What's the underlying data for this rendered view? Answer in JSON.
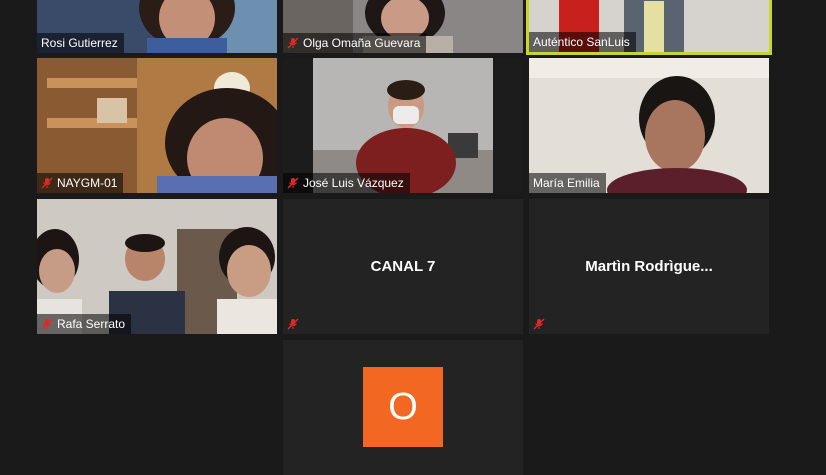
{
  "participants": [
    {
      "name": "Rosi Gutierrez",
      "muted": false
    },
    {
      "name": "Olga Omaña Guevara",
      "muted": true
    },
    {
      "name": "Auténtico SanLuis",
      "muted": false,
      "active_speaker": true
    },
    {
      "name": "NAYGM-01",
      "muted": true
    },
    {
      "name": "José Luis Vázquez",
      "muted": true
    },
    {
      "name": "María Emilia",
      "muted": false
    },
    {
      "name": "Rafa Serrato",
      "muted": true
    },
    {
      "name": "CANAL 7",
      "muted": true,
      "video_off": true
    },
    {
      "name": "Martìn  Rodrìgue...",
      "muted": true,
      "video_off": true
    },
    {
      "avatar_initial": "O",
      "video_off": true
    }
  ],
  "colors": {
    "background": "#1a1a1a",
    "tile": "#232323",
    "active_speaker_border": "#c8d62a",
    "mute_icon": "#e02828",
    "avatar": "#f26722"
  }
}
